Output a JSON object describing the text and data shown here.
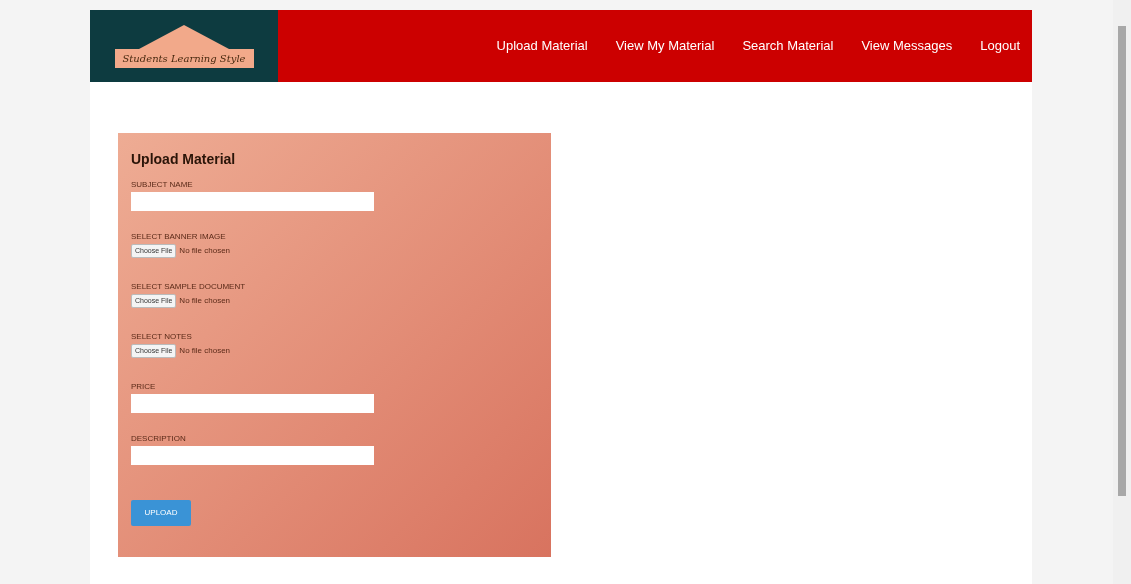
{
  "logo": {
    "text": "Students Learning Style"
  },
  "nav": [
    {
      "label": "Upload Material"
    },
    {
      "label": "View My Material"
    },
    {
      "label": "Search Material"
    },
    {
      "label": "View Messages"
    },
    {
      "label": "Logout"
    }
  ],
  "form": {
    "title": "Upload Material",
    "fields": [
      {
        "kind": "text",
        "label": "SUBJECT NAME"
      },
      {
        "kind": "file",
        "label": "SELECT BANNER IMAGE",
        "button": "Choose File",
        "status": "No file chosen"
      },
      {
        "kind": "file",
        "label": "SELECT SAMPLE DOCUMENT",
        "button": "Choose File",
        "status": "No file chosen"
      },
      {
        "kind": "file",
        "label": "SELECT NOTES",
        "button": "Choose File",
        "status": "No file chosen"
      },
      {
        "kind": "text",
        "label": "PRICE"
      },
      {
        "kind": "text",
        "label": "DESCRIPTION"
      }
    ],
    "submit": "UPLOAD"
  }
}
